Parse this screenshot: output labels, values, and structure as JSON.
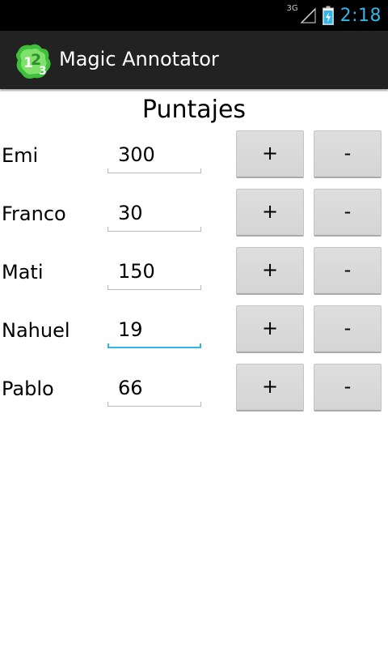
{
  "status_bar": {
    "network": "3G",
    "time": "2:18",
    "accent_color": "#33b5e5",
    "icons": [
      "signal-icon",
      "battery-charging-icon"
    ]
  },
  "action_bar": {
    "app_name": "Magic Annotator",
    "background_color": "#222222",
    "icon": "app-logo-icon"
  },
  "main": {
    "title": "Puntajes",
    "rows": [
      {
        "name": "Emi",
        "score": "300",
        "plus_label": "+",
        "minus_label": "-"
      },
      {
        "name": "Franco",
        "score": "30",
        "plus_label": "+",
        "minus_label": "-"
      },
      {
        "name": "Mati",
        "score": "150",
        "plus_label": "+",
        "minus_label": "-"
      },
      {
        "name": "Nahuel",
        "score": "19",
        "plus_label": "+",
        "minus_label": "-",
        "focused": true
      },
      {
        "name": "Pablo",
        "score": "66",
        "plus_label": "+",
        "minus_label": "-"
      }
    ]
  }
}
